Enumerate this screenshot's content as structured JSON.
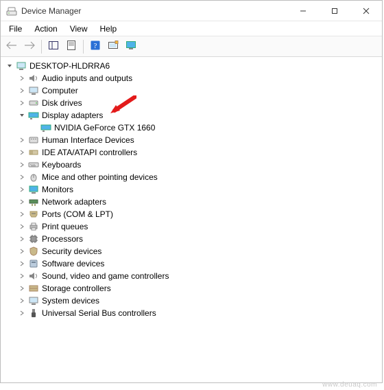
{
  "window": {
    "title": "Device Manager"
  },
  "menubar": {
    "file": "File",
    "action": "Action",
    "view": "View",
    "help": "Help"
  },
  "tree": {
    "root": "DESKTOP-HLDRRA6",
    "nodes": {
      "audio": "Audio inputs and outputs",
      "computer": "Computer",
      "disk": "Disk drives",
      "display": "Display adapters",
      "display_child": "NVIDIA GeForce GTX 1660",
      "hid": "Human Interface Devices",
      "ide": "IDE ATA/ATAPI controllers",
      "keyboards": "Keyboards",
      "mice": "Mice and other pointing devices",
      "monitors": "Monitors",
      "network": "Network adapters",
      "ports": "Ports (COM & LPT)",
      "printq": "Print queues",
      "processors": "Processors",
      "security": "Security devices",
      "software": "Software devices",
      "sound": "Sound, video and game controllers",
      "storage": "Storage controllers",
      "system": "System devices",
      "usb": "Universal Serial Bus controllers"
    }
  },
  "watermark": "www.deuaq.com"
}
